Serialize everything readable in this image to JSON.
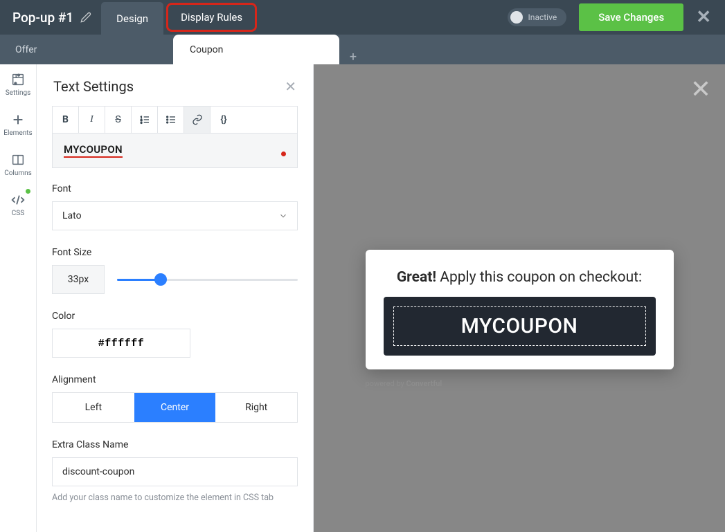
{
  "header": {
    "title": "Pop-up #1",
    "tabs": {
      "design": "Design",
      "display_rules": "Display Rules"
    },
    "toggle_label": "Inactive",
    "save_label": "Save Changes"
  },
  "subtabs": {
    "offer": "Offer",
    "coupon": "Coupon"
  },
  "sidebar": {
    "settings": "Settings",
    "elements": "Elements",
    "columns": "Columns",
    "css": "CSS"
  },
  "panel": {
    "title": "Text Settings",
    "rte_value": "MYCOUPON",
    "font": {
      "label": "Font",
      "value": "Lato"
    },
    "font_size": {
      "label": "Font Size",
      "value": "33px",
      "percent": 24
    },
    "color": {
      "label": "Color",
      "value": "#ffffff"
    },
    "alignment": {
      "label": "Alignment",
      "options": [
        "Left",
        "Center",
        "Right"
      ],
      "active": "Center"
    },
    "extra_class": {
      "label": "Extra Class Name",
      "value": "discount-coupon",
      "hint": "Add your class name to customize the element in CSS tab"
    }
  },
  "preview": {
    "heading_strong": "Great!",
    "heading_rest": " Apply this coupon on checkout:",
    "coupon_code": "MYCOUPON",
    "powered_prefix": "powered by ",
    "powered_brand": "Convertful"
  }
}
